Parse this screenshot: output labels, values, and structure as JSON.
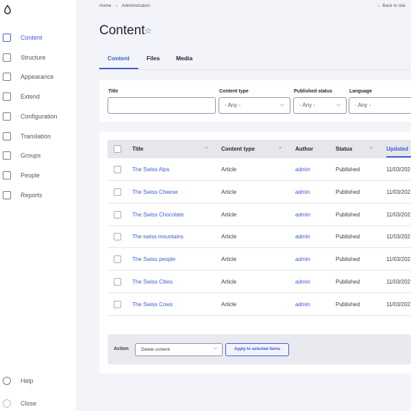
{
  "sidebar": {
    "items": [
      {
        "label": "Content",
        "icon": "content-icon",
        "active": true
      },
      {
        "label": "Structure",
        "icon": "structure-icon"
      },
      {
        "label": "Appearance",
        "icon": "appearance-icon"
      },
      {
        "label": "Extend",
        "icon": "extend-icon"
      },
      {
        "label": "Configuration",
        "icon": "configuration-icon"
      },
      {
        "label": "Translation",
        "icon": "globe-icon"
      },
      {
        "label": "Groups",
        "icon": "groups-icon"
      },
      {
        "label": "People",
        "icon": "person-icon"
      },
      {
        "label": "Reports",
        "icon": "reports-icon"
      }
    ],
    "help": "Help",
    "close": "Close"
  },
  "breadcrumb": {
    "home": "Home",
    "sep": "›",
    "admin": "Administration"
  },
  "back_to_site": "← Back to site",
  "page_title": "Content",
  "tabs": [
    "Content",
    "Files",
    "Media"
  ],
  "filters": {
    "title_label": "Title",
    "title_value": "",
    "type_label": "Content type",
    "type_value": "- Any -",
    "status_label": "Published status",
    "status_value": "- Any -",
    "lang_label": "Language",
    "lang_value": "- Any -"
  },
  "table": {
    "headers": [
      "Title",
      "Content type",
      "Author",
      "Status",
      "Updated"
    ],
    "rows": [
      {
        "title": "The Swiss Alps",
        "type": "Article",
        "author": "admin",
        "status": "Published",
        "updated": "11/03/202"
      },
      {
        "title": "The Swiss Cheese",
        "type": "Article",
        "author": "admin",
        "status": "Published",
        "updated": "11/03/202"
      },
      {
        "title": "The Swiss Chocolate",
        "type": "Article",
        "author": "admin",
        "status": "Published",
        "updated": "11/03/202"
      },
      {
        "title": "The swiss mountains",
        "type": "Article",
        "author": "admin",
        "status": "Published",
        "updated": "11/03/202"
      },
      {
        "title": "The Swiss people",
        "type": "Article",
        "author": "admin",
        "status": "Published",
        "updated": "11/03/202"
      },
      {
        "title": "The Swiss Cities",
        "type": "Article",
        "author": "admin",
        "status": "Published",
        "updated": "11/03/202"
      },
      {
        "title": "The Swiss Cows",
        "type": "Article",
        "author": "admin",
        "status": "Published",
        "updated": "11/03/202"
      }
    ]
  },
  "action": {
    "label": "Action",
    "select_value": "Delete content",
    "apply": "Apply to selected items"
  },
  "colors": {
    "accent": "#3b5bd6"
  }
}
